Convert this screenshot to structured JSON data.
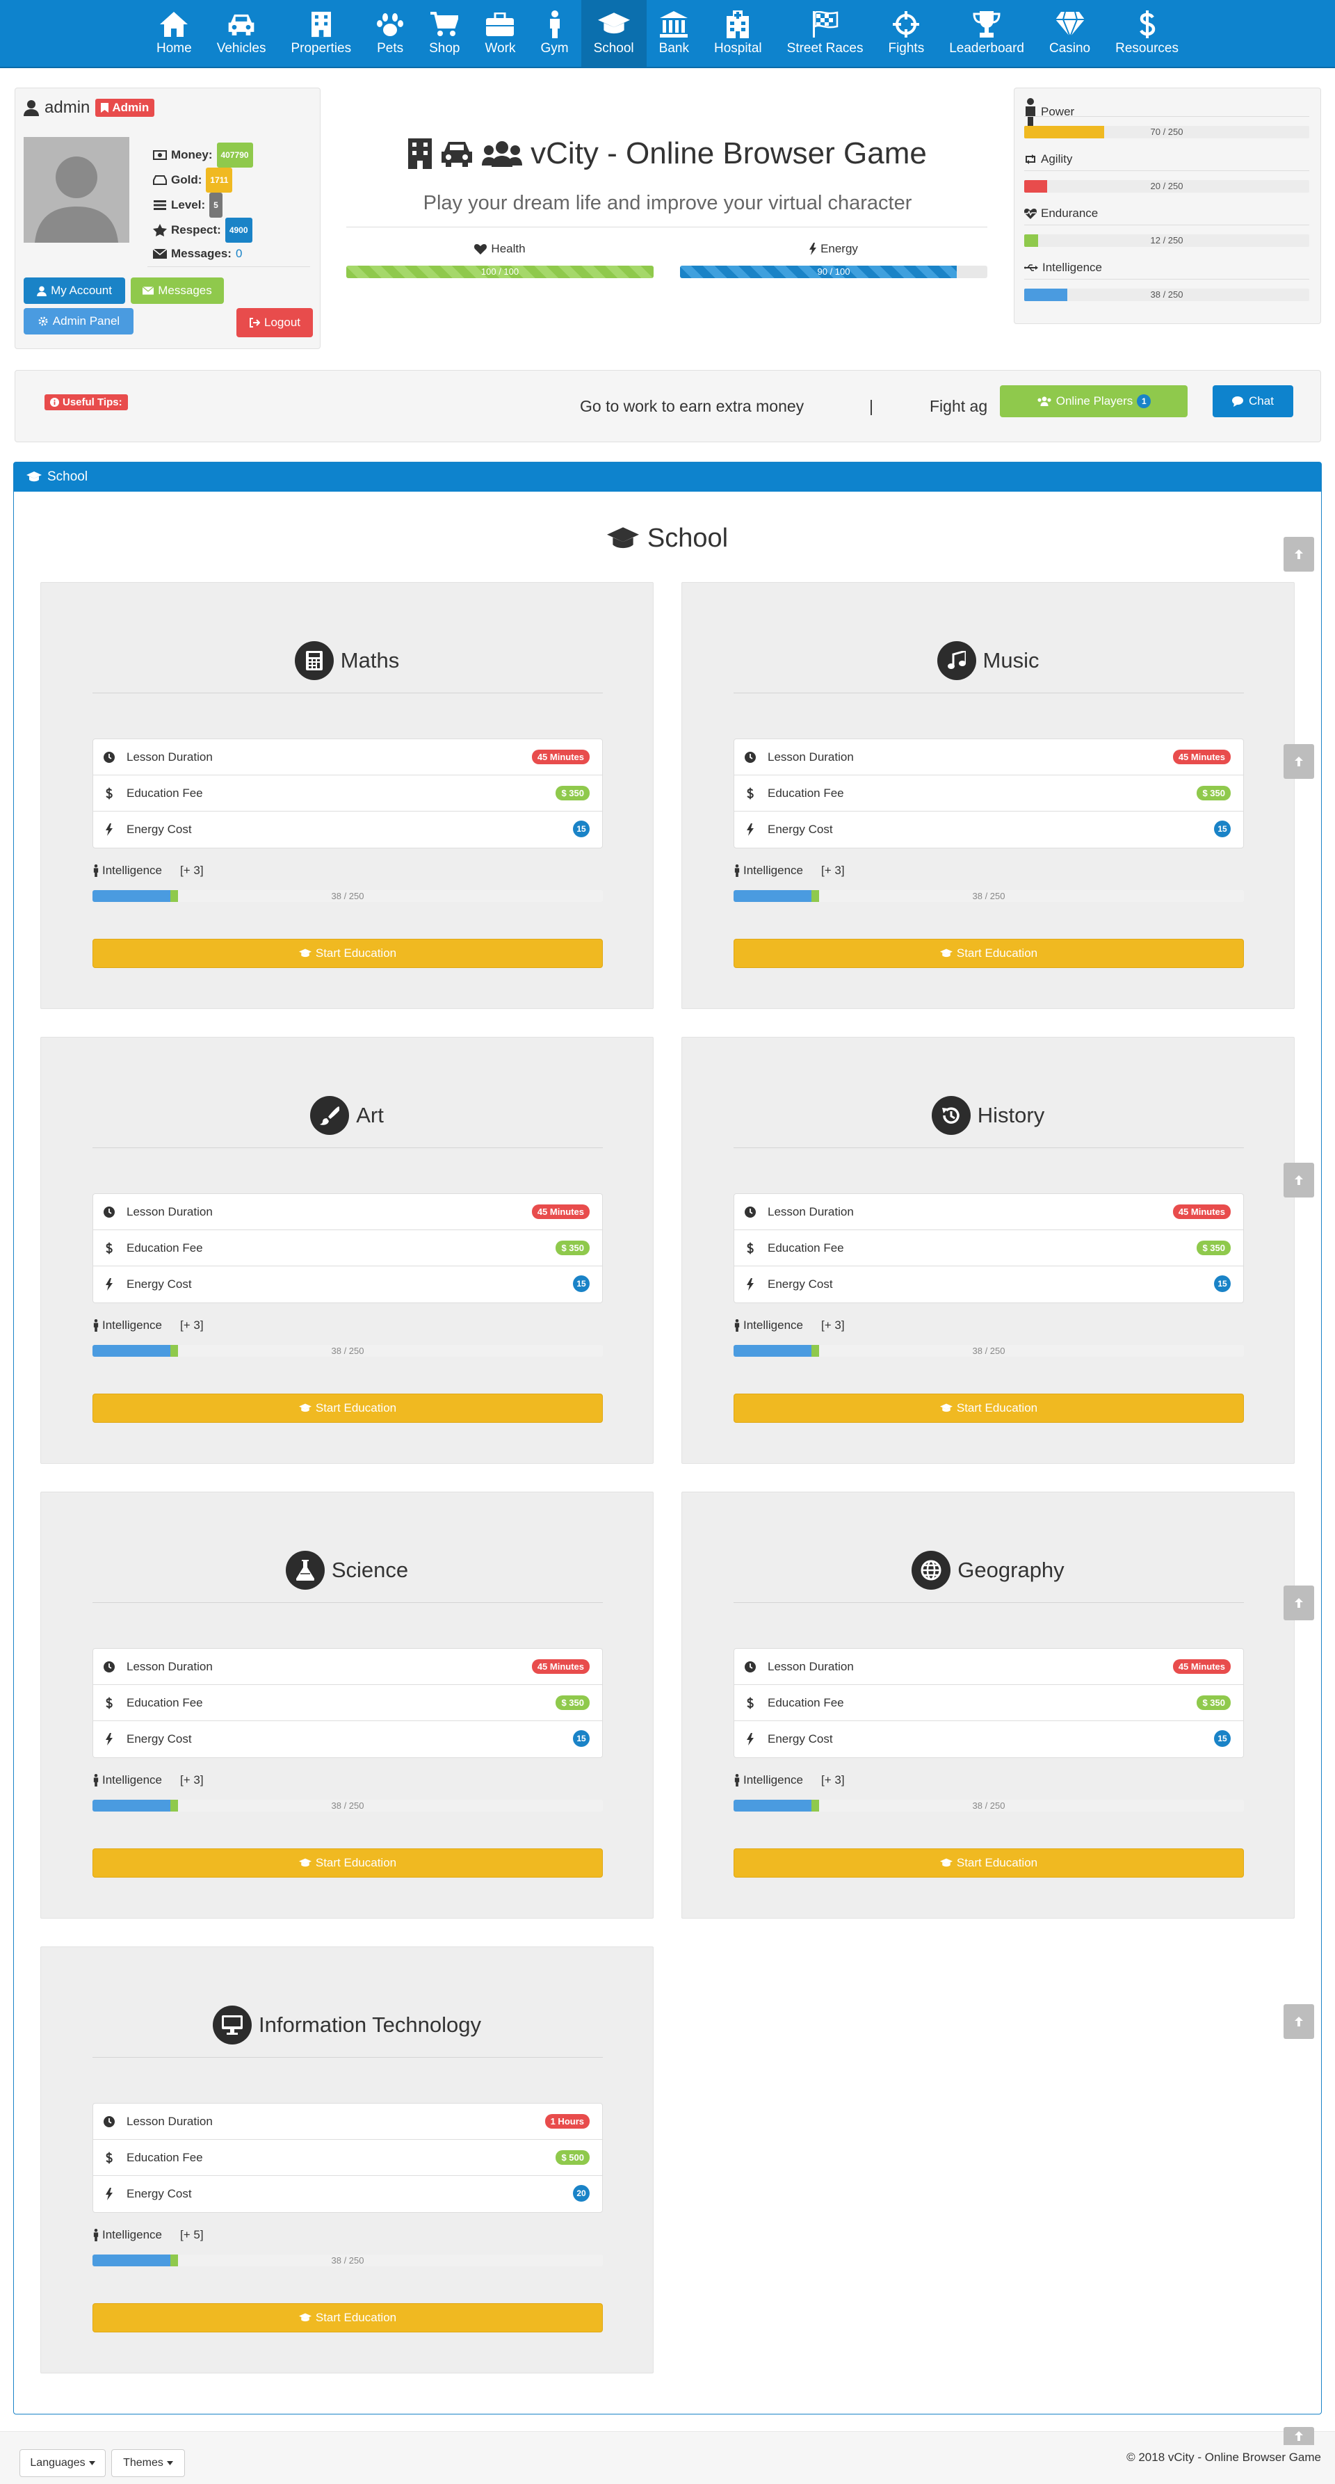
{
  "nav": [
    {
      "label": "Home",
      "icon": "home-icon"
    },
    {
      "label": "Vehicles",
      "icon": "car-icon"
    },
    {
      "label": "Properties",
      "icon": "building-icon"
    },
    {
      "label": "Pets",
      "icon": "paw-icon"
    },
    {
      "label": "Shop",
      "icon": "cart-icon"
    },
    {
      "label": "Work",
      "icon": "briefcase-icon"
    },
    {
      "label": "Gym",
      "icon": "male-icon"
    },
    {
      "label": "School",
      "icon": "graduation-cap-icon",
      "active": true
    },
    {
      "label": "Bank",
      "icon": "bank-icon"
    },
    {
      "label": "Hospital",
      "icon": "hospital-icon"
    },
    {
      "label": "Street Races",
      "icon": "flag-checkered-icon"
    },
    {
      "label": "Fights",
      "icon": "crosshairs-icon"
    },
    {
      "label": "Leaderboard",
      "icon": "trophy-icon"
    },
    {
      "label": "Casino",
      "icon": "diamond-icon"
    },
    {
      "label": "Resources",
      "icon": "dollar-icon"
    }
  ],
  "user": {
    "name": "admin",
    "role": "Admin",
    "money_label": "Money:",
    "money": "407790",
    "gold_label": "Gold:",
    "gold": "1711",
    "level_label": "Level:",
    "level": "5",
    "respect_label": "Respect:",
    "respect": "4900",
    "messages_label": "Messages:",
    "messages": "0",
    "buttons": {
      "account": "My Account",
      "messages": "Messages",
      "admin": "Admin Panel",
      "logout": "Logout"
    }
  },
  "brand": {
    "title": "vCity - Online Browser Game",
    "tagline": "Play your dream life and improve your virtual character"
  },
  "vitals": {
    "health": {
      "label": "Health",
      "text": "100 / 100",
      "value": 1.0
    },
    "energy": {
      "label": "Energy",
      "text": "90 / 100",
      "value": 0.9
    }
  },
  "attributes": [
    {
      "name": "Power",
      "text": "70 / 250",
      "value": 0.28,
      "color": "#f0b921",
      "icon": "male-icon"
    },
    {
      "name": "Agility",
      "text": "20 / 250",
      "value": 0.08,
      "color": "#e84c4c",
      "icon": "retweet-icon"
    },
    {
      "name": "Endurance",
      "text": "12 / 250",
      "value": 0.048,
      "color": "#8fc94c",
      "icon": "heartbeat-icon"
    },
    {
      "name": "Intelligence",
      "text": "38 / 250",
      "value": 0.152,
      "color": "#4a9be0",
      "icon": "usb-icon"
    }
  ],
  "tips": {
    "label": "Useful Tips:",
    "text1": "Go to work to earn extra money",
    "separator": "|",
    "text2": "Fight ag",
    "online": "Online Players",
    "online_count": "1",
    "chat": "Chat"
  },
  "section": {
    "title": "School",
    "heading": "School"
  },
  "courses": [
    {
      "name": "Maths",
      "icon": "calculator-icon",
      "duration": "45 Minutes",
      "fee": "$ 350",
      "energy": "15",
      "intel_bonus": "[+ 3]"
    },
    {
      "name": "Music",
      "icon": "music-icon",
      "duration": "45 Minutes",
      "fee": "$ 350",
      "energy": "15",
      "intel_bonus": "[+ 3]"
    },
    {
      "name": "Art",
      "icon": "paint-brush-icon",
      "duration": "45 Minutes",
      "fee": "$ 350",
      "energy": "15",
      "intel_bonus": "[+ 3]"
    },
    {
      "name": "History",
      "icon": "history-icon",
      "duration": "45 Minutes",
      "fee": "$ 350",
      "energy": "15",
      "intel_bonus": "[+ 3]"
    },
    {
      "name": "Science",
      "icon": "flask-icon",
      "duration": "45 Minutes",
      "fee": "$ 350",
      "energy": "15",
      "intel_bonus": "[+ 3]"
    },
    {
      "name": "Geography",
      "icon": "globe-icon",
      "duration": "45 Minutes",
      "fee": "$ 350",
      "energy": "15",
      "intel_bonus": "[+ 3]"
    },
    {
      "name": "Information Technology",
      "icon": "desktop-icon",
      "duration": "1 Hours",
      "fee": "$ 500",
      "energy": "20",
      "intel_bonus": "[+ 5]"
    }
  ],
  "course_labels": {
    "duration": "Lesson Duration",
    "fee": "Education Fee",
    "energy": "Energy Cost",
    "intel": "Intelligence",
    "progress": "38 / 250",
    "progress_value": 0.152,
    "gain_value": 0.016,
    "button": "Start Education"
  },
  "footer": {
    "languages": "Languages",
    "themes": "Themes",
    "copyright": "© 2018 vCity - Online Browser Game"
  }
}
